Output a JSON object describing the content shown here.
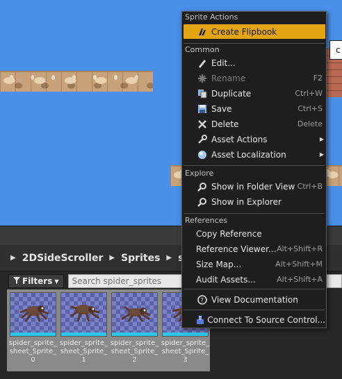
{
  "viewport": {
    "chip_text": "c"
  },
  "breadcrumb": [
    "2DSideScroller",
    "Sprites",
    "spider_sprites"
  ],
  "breadcrumb_visible": [
    "2DSideScroller",
    "Sprites",
    "spid"
  ],
  "filters": {
    "label": "Filters",
    "search_placeholder": "Search spider_sprites"
  },
  "assets": [
    {
      "name": "spider_sprite_sheet_Sprite_0",
      "label_lines": [
        "spider_sprite_",
        "sheet_Sprite_",
        "0"
      ]
    },
    {
      "name": "spider_sprite_sheet_Sprite_1",
      "label_lines": [
        "spider_sprite_",
        "sheet_Sprite_",
        "1"
      ]
    },
    {
      "name": "spider_sprite_sheet_Sprite_2",
      "label_lines": [
        "spider_sprite_",
        "sheet_Sprite_",
        "2"
      ]
    },
    {
      "name": "spider_sprite_sheet_Sprite_3",
      "label_lines": [
        "spider_sprite_",
        "sheet_Sprite_",
        "3"
      ]
    }
  ],
  "menu": {
    "sections": {
      "sprite_actions": "Sprite Actions",
      "common": "Common",
      "explore": "Explore",
      "references": "References"
    },
    "items": {
      "create_flipbook": {
        "label": "Create Flipbook",
        "icon": "flipbook-icon"
      },
      "edit": {
        "label": "Edit...",
        "icon": "edit-icon"
      },
      "rename": {
        "label": "Rename",
        "shortcut": "F2",
        "icon": "rename-icon"
      },
      "duplicate": {
        "label": "Duplicate",
        "shortcut": "Ctrl+W",
        "icon": "duplicate-icon"
      },
      "save": {
        "label": "Save",
        "shortcut": "Ctrl+S",
        "icon": "save-icon"
      },
      "delete": {
        "label": "Delete",
        "shortcut": "Delete",
        "icon": "delete-icon"
      },
      "asset_actions": {
        "label": "Asset Actions",
        "icon": "wrench-icon"
      },
      "asset_localization": {
        "label": "Asset Localization",
        "icon": "globe-icon"
      },
      "show_in_folder_view": {
        "label": "Show in Folder View",
        "shortcut": "Ctrl+B",
        "icon": "magnifier-icon"
      },
      "show_in_explorer": {
        "label": "Show in Explorer",
        "icon": "magnifier-icon"
      },
      "copy_reference": {
        "label": "Copy Reference"
      },
      "reference_viewer": {
        "label": "Reference Viewer...",
        "shortcut": "Alt+Shift+R"
      },
      "size_map": {
        "label": "Size Map...",
        "shortcut": "Alt+Shift+M"
      },
      "audit_assets": {
        "label": "Audit Assets...",
        "shortcut": "Alt+Shift+A"
      },
      "view_documentation": {
        "label": "View Documentation",
        "icon": "help-icon"
      },
      "connect_source_control": {
        "label": "Connect To Source Control...",
        "icon": "source-control-icon"
      }
    }
  },
  "colors": {
    "highlight": "#e3a512",
    "sky": "#4a90e8",
    "thumb_bar": "#2ec6e6"
  }
}
